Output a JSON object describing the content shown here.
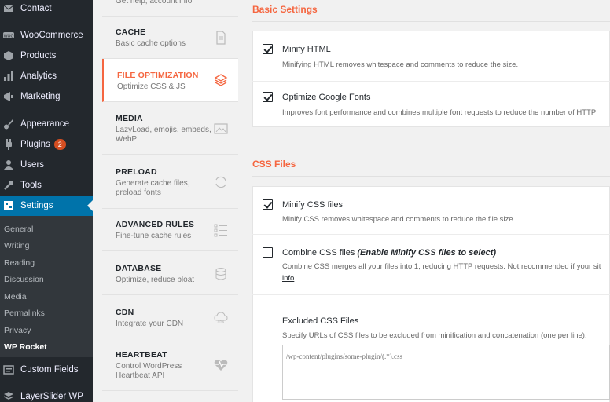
{
  "wp_menu": {
    "items": [
      {
        "label": "Contact",
        "icon": "mail-icon"
      },
      {
        "label": "WooCommerce",
        "icon": "woo-icon"
      },
      {
        "label": "Products",
        "icon": "box-icon"
      },
      {
        "label": "Analytics",
        "icon": "bar-chart-icon"
      },
      {
        "label": "Marketing",
        "icon": "megaphone-icon"
      },
      {
        "label": "Appearance",
        "icon": "paintbrush-icon"
      },
      {
        "label": "Plugins",
        "icon": "plugin-icon",
        "badge": "2"
      },
      {
        "label": "Users",
        "icon": "user-icon"
      },
      {
        "label": "Tools",
        "icon": "wrench-icon"
      },
      {
        "label": "Settings",
        "icon": "settings-icon"
      },
      {
        "label": "Custom Fields",
        "icon": "custom-fields-icon"
      },
      {
        "label": "LayerSlider WP",
        "icon": "layers-icon"
      }
    ],
    "submenu": [
      "General",
      "Writing",
      "Reading",
      "Discussion",
      "Media",
      "Permalinks",
      "Privacy",
      "WP Rocket"
    ],
    "active_color": "#0073aa"
  },
  "rocket_nav": {
    "partial_desc": "Get help, account info",
    "items": [
      {
        "title": "CACHE",
        "desc": "Basic cache options",
        "icon": "document-icon"
      },
      {
        "title": "FILE OPTIMIZATION",
        "desc": "Optimize CSS & JS",
        "icon": "stack-icon"
      },
      {
        "title": "MEDIA",
        "desc": "LazyLoad, emojis, embeds, WebP",
        "icon": "image-icon"
      },
      {
        "title": "PRELOAD",
        "desc": "Generate cache files, preload fonts",
        "icon": "refresh-icon"
      },
      {
        "title": "ADVANCED RULES",
        "desc": "Fine-tune cache rules",
        "icon": "list-icon"
      },
      {
        "title": "DATABASE",
        "desc": "Optimize, reduce bloat",
        "icon": "database-icon"
      },
      {
        "title": "CDN",
        "desc": "Integrate your CDN",
        "icon": "cdn-icon"
      },
      {
        "title": "HEARTBEAT",
        "desc": "Control WordPress Heartbeat API",
        "icon": "heartbeat-icon"
      }
    ],
    "active_color": "#f56640"
  },
  "main": {
    "basic_title": "Basic Settings",
    "minify_html": {
      "label": "Minify HTML",
      "desc": "Minifying HTML removes whitespace and comments to reduce the size.",
      "checked": true
    },
    "optimize_fonts": {
      "label": "Optimize Google Fonts",
      "desc": "Improves font performance and combines multiple font requests to reduce the number of HTTP",
      "checked": true
    },
    "css_title": "CSS Files",
    "minify_css": {
      "label": "Minify CSS files",
      "desc": "Minify CSS removes whitespace and comments to reduce the file size.",
      "checked": true
    },
    "combine_css": {
      "label": "Combine CSS files ",
      "label_em": "(Enable Minify CSS files to select)",
      "desc": "Combine CSS merges all your files into 1, reducing HTTP requests. Not recommended if your sit",
      "more": "info",
      "checked": false
    },
    "excluded": {
      "label": "Excluded CSS Files",
      "desc": "Specify URLs of CSS files to be excluded from minification and concatenation (one per line).",
      "placeholder": "/wp-content/plugins/some-plugin/(.*).css"
    }
  }
}
